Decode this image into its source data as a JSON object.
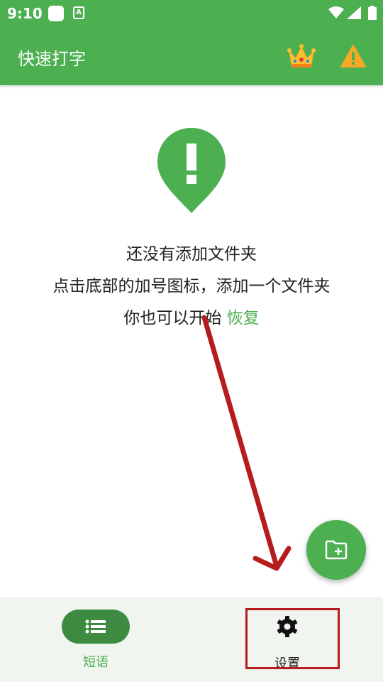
{
  "status_bar": {
    "time": "9:10",
    "notification_icons": [
      "app-notification-icon",
      "a-letter-notification-icon"
    ],
    "system_icons": [
      "wifi-icon",
      "cell-signal-icon",
      "battery-icon"
    ]
  },
  "app_bar": {
    "title": "快速打字",
    "background_color": "#4caf50",
    "actions": [
      "crown-icon",
      "warning-icon"
    ]
  },
  "empty_state": {
    "icon": "exclamation-pin-icon",
    "line1": "还没有添加文件夹",
    "line2": "点击底部的加号图标，添加一个文件夹",
    "line3_prefix": "你也可以开始 ",
    "restore_link": "恢复"
  },
  "fab": {
    "icon": "add-folder-icon"
  },
  "bottom_nav": {
    "items": [
      {
        "label": "短语",
        "icon": "list-icon",
        "selected": true
      },
      {
        "label": "设置",
        "icon": "gear-icon",
        "selected": false
      }
    ]
  },
  "annotation": {
    "arrow_color": "#b71c1c",
    "highlight_color": "#b71c1c"
  },
  "colors": {
    "primary": "#4caf50",
    "primary_dark": "#3d8b40",
    "nav_background": "#f1f5ef"
  }
}
